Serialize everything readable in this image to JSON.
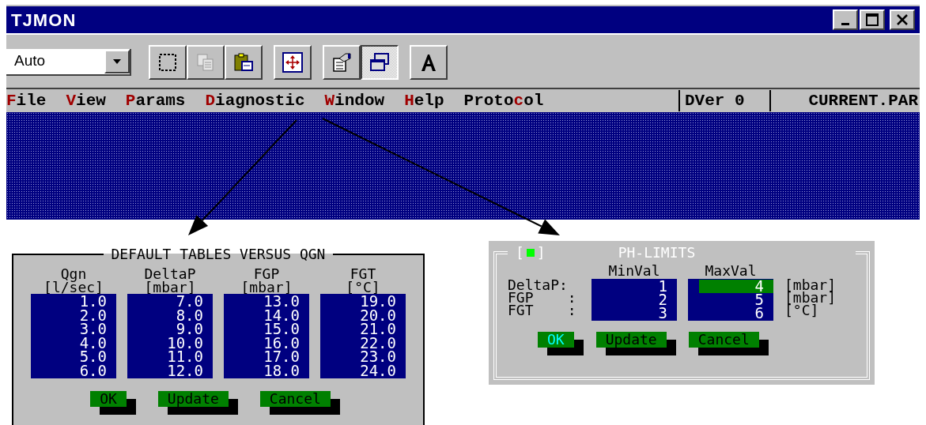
{
  "window": {
    "title": "TJMON"
  },
  "toolbar": {
    "combo": {
      "value": "Auto"
    },
    "tools": [
      {
        "disabled": false,
        "pressed": false
      },
      {
        "disabled": true,
        "pressed": false
      },
      {
        "disabled": false,
        "pressed": false
      },
      {
        "disabled": false,
        "pressed": false
      },
      {
        "disabled": false,
        "pressed": false
      },
      {
        "disabled": false,
        "pressed": true
      },
      {
        "disabled": false,
        "pressed": false
      }
    ]
  },
  "menu": [
    {
      "key": "F",
      "after": "ile"
    },
    {
      "key": "V",
      "after": "iew"
    },
    {
      "key": "P",
      "after": "arams"
    },
    {
      "key": "D",
      "after": "iagnostic"
    },
    {
      "key": "W",
      "after": "indow"
    },
    {
      "key": "H",
      "after": "elp"
    },
    {
      "before": "Proto",
      "key": "c",
      "after": "ol"
    }
  ],
  "status_fields": [
    "DVer 0",
    "CURRENT.PAR"
  ],
  "default_tables": {
    "title": "DEFAULT TABLES VERSUS QGN",
    "columns": [
      {
        "name": "Qgn",
        "unit": "[l/sec]",
        "values": [
          "1.0",
          "2.0",
          "3.0",
          "4.0",
          "5.0",
          "6.0"
        ]
      },
      {
        "name": "DeltaP",
        "unit": "[mbar]",
        "values": [
          "7.0",
          "8.0",
          "9.0",
          "10.0",
          "11.0",
          "12.0"
        ]
      },
      {
        "name": "FGP",
        "unit": "[mbar]",
        "values": [
          "13.0",
          "14.0",
          "15.0",
          "16.0",
          "17.0",
          "18.0"
        ]
      },
      {
        "name": "FGT",
        "unit": "[°C]",
        "values": [
          "19.0",
          "20.0",
          "21.0",
          "22.0",
          "23.0",
          "24.0"
        ]
      }
    ],
    "buttons": [
      {
        "label": "OK",
        "focused": false
      },
      {
        "label": "Update",
        "focused": false
      },
      {
        "label": "Cancel",
        "focused": false
      }
    ]
  },
  "ph_limits": {
    "title": "PH-LIMITS",
    "close_box": {
      "open": "[",
      "close": "]"
    },
    "headers": [
      "MinVal",
      "MaxVal"
    ],
    "rows": [
      {
        "label": "DeltaP:",
        "min": {
          "value": "1",
          "selected": false
        },
        "max": {
          "value": "4",
          "selected": true
        },
        "unit": "[mbar]"
      },
      {
        "label": "FGP    :",
        "min": {
          "value": "2",
          "selected": false
        },
        "max": {
          "value": "5",
          "selected": false
        },
        "unit": "[mbar]"
      },
      {
        "label": "FGT    :",
        "min": {
          "value": "3",
          "selected": false
        },
        "max": {
          "value": "6",
          "selected": false
        },
        "unit": "[°C]"
      }
    ],
    "buttons": [
      {
        "label": "OK",
        "focused": true
      },
      {
        "label": "Update",
        "focused": false
      },
      {
        "label": "Cancel",
        "focused": false
      }
    ]
  }
}
